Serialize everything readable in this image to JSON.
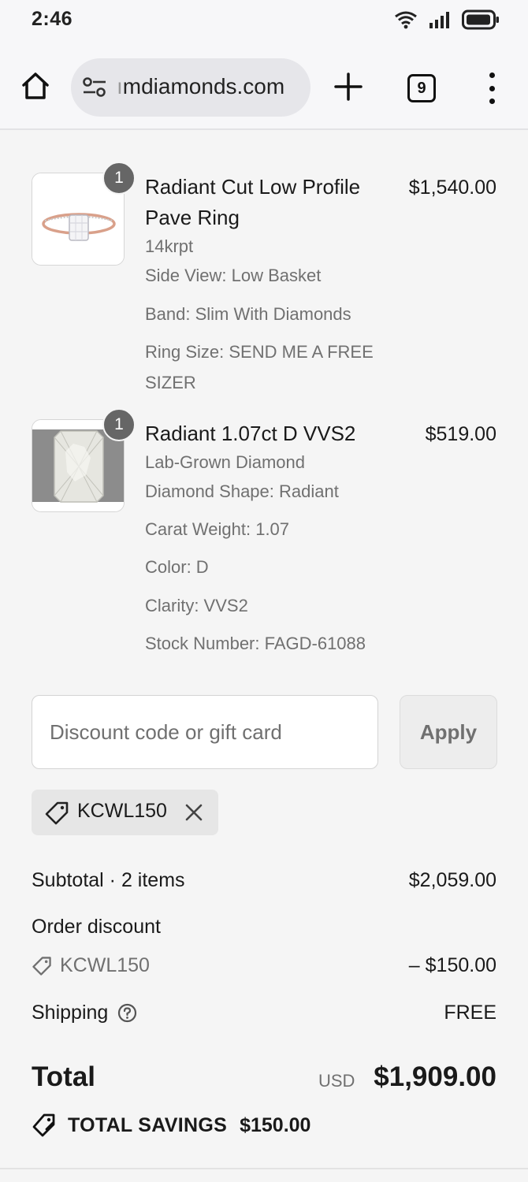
{
  "status_bar": {
    "time": "2:46"
  },
  "browser": {
    "url": "mdiamonds.com",
    "url_prefix": "ı",
    "tab_count": "9"
  },
  "items": [
    {
      "quantity": "1",
      "name": "Radiant Cut Low Profile Pave Ring",
      "price": "$1,540.00",
      "options": [
        "14krpt",
        "Side View: Low Basket",
        "Band: Slim With Diamonds",
        "Ring Size: SEND ME A FREE SIZER"
      ]
    },
    {
      "quantity": "1",
      "name": "Radiant 1.07ct D VVS2",
      "price": "$519.00",
      "options": [
        "Lab-Grown Diamond",
        "Diamond Shape: Radiant",
        "Carat Weight: 1.07",
        "Color: D",
        "Clarity: VVS2",
        "Stock Number: FAGD-61088"
      ]
    }
  ],
  "discount": {
    "placeholder": "Discount code or gift card",
    "apply_label": "Apply",
    "applied_code": "KCWL150"
  },
  "summary": {
    "subtotal_label": "Subtotal · 2 items",
    "subtotal_value": "$2,059.00",
    "order_discount_label": "Order discount",
    "order_discount_code": "KCWL150",
    "order_discount_value": "– $150.00",
    "shipping_label": "Shipping",
    "shipping_value": "FREE",
    "total_label": "Total",
    "total_currency": "USD",
    "total_value": "$1,909.00",
    "savings_label": "TOTAL SAVINGS",
    "savings_value": "$150.00"
  },
  "colors": {
    "page_bg": "#f5f5f5",
    "muted_text": "#707070",
    "badge_bg": "#666666",
    "rose_gold": "#d9a08a"
  }
}
